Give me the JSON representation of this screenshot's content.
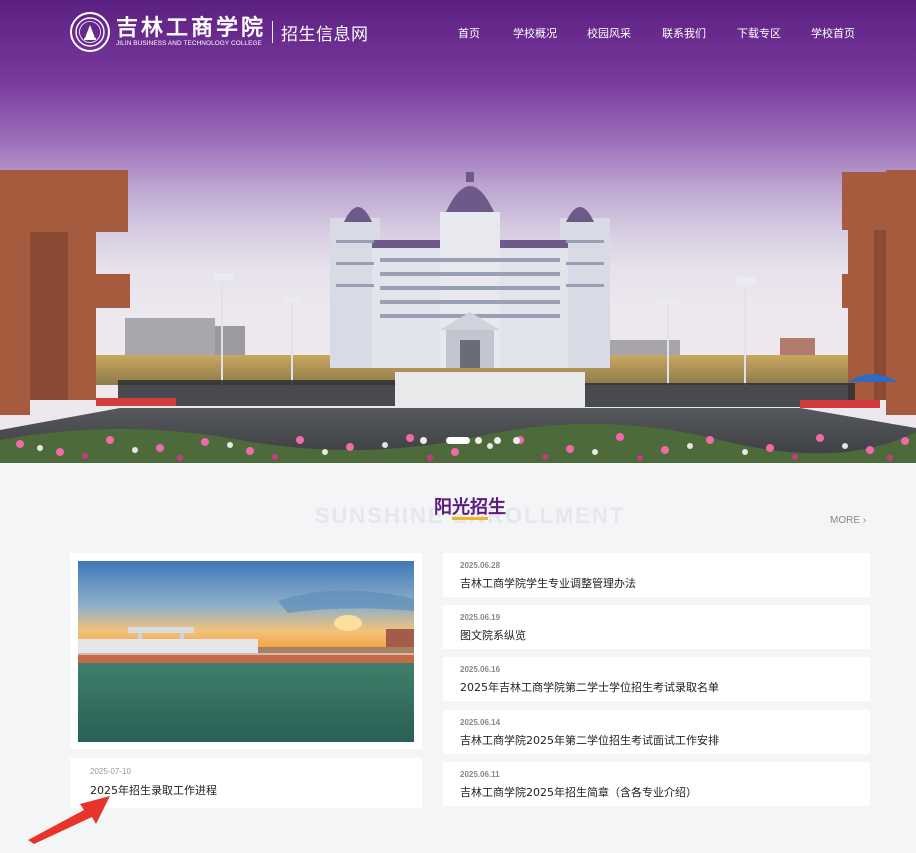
{
  "header": {
    "logo_cn": "吉林工商学院",
    "logo_en": "JILIN BUSINESS AND TECHNOLOGY COLLEGE",
    "site_name": "招生信息网"
  },
  "nav": {
    "items": [
      "首页",
      "学校概况",
      "校园风采",
      "联系我们",
      "下载专区",
      "学校首页"
    ]
  },
  "slider": {
    "slide_count": 5,
    "active_index": 1
  },
  "section": {
    "bg_title": "SUNSHINE ENROLLMENT",
    "title": "阳光招生",
    "more_label": "MORE ›"
  },
  "featured": {
    "date": "2025-07-10",
    "title": "2025年招生录取工作进程"
  },
  "news": [
    {
      "date": "2025.06.28",
      "title": "吉林工商学院学生专业调整管理办法"
    },
    {
      "date": "2025.06.19",
      "title": "图文院系纵览"
    },
    {
      "date": "2025.06.16",
      "title": "2025年吉林工商学院第二学士学位招生考试录取名单"
    },
    {
      "date": "2025.06.14",
      "title": "吉林工商学院2025年第二学位招生考试面试工作安排"
    },
    {
      "date": "2025.06.11",
      "title": "吉林工商学院2025年招生简章（含各专业介绍）"
    }
  ],
  "colors": {
    "brand_purple": "#5b1a7c",
    "accent_gold": "#f0b429",
    "annotation_red": "#e8332a"
  }
}
